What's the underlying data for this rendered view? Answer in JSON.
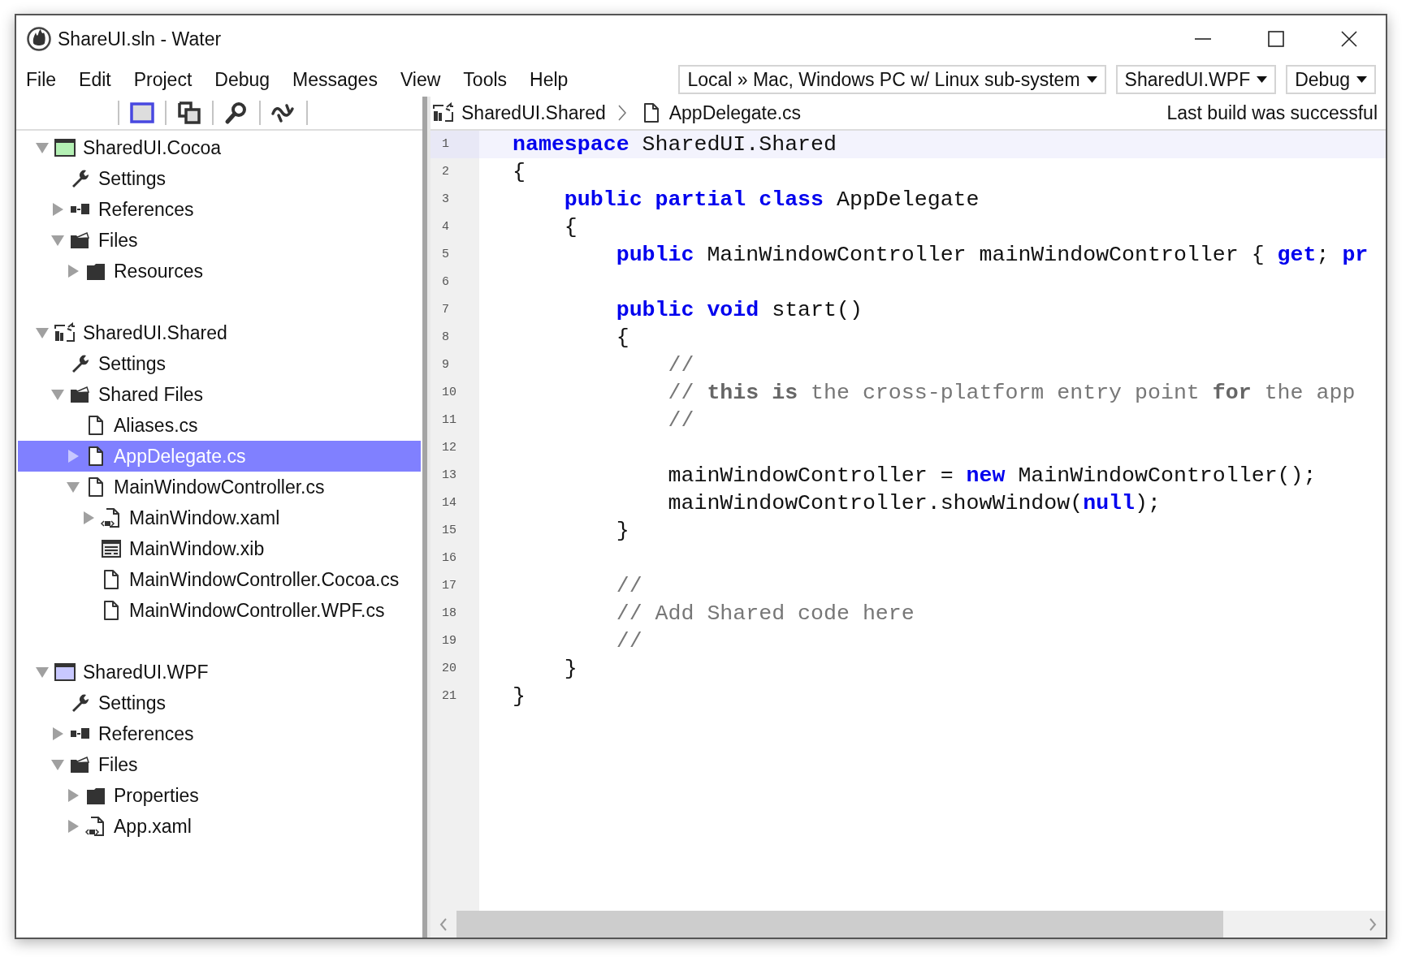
{
  "window": {
    "title": "ShareUI.sln - Water"
  },
  "menu": [
    "File",
    "Edit",
    "Project",
    "Debug",
    "Messages",
    "View",
    "Tools",
    "Help"
  ],
  "dropdowns": [
    {
      "value": "Local » Mac, Windows PC w/ Linux sub-system"
    },
    {
      "value": "SharedUI.WPF"
    },
    {
      "value": "Debug"
    }
  ],
  "toolbar": [
    {
      "kind": "square"
    },
    {
      "kind": "copy"
    },
    {
      "kind": "search"
    },
    {
      "kind": "squiggle"
    }
  ],
  "solution_tree": [
    {
      "label": "SharedUI.Cocoa",
      "kind": "window",
      "color": "#b4f0b4",
      "expanded": true,
      "selected": false,
      "children": [
        {
          "label": "Settings",
          "kind": "wrench",
          "selected": false
        },
        {
          "label": "References",
          "kind": "references",
          "expanded": false,
          "selected": false
        },
        {
          "label": "Files",
          "kind": "folder-open",
          "expanded": true,
          "selected": false,
          "children": [
            {
              "label": "Resources",
              "kind": "folder",
              "expanded": false,
              "selected": false
            }
          ]
        }
      ]
    },
    {
      "label": "SharedUI.Shared",
      "kind": "shared-project",
      "expanded": true,
      "selected": false,
      "children": [
        {
          "label": "Settings",
          "kind": "wrench",
          "selected": false
        },
        {
          "label": "Shared Files",
          "kind": "folder-open",
          "expanded": true,
          "selected": false,
          "children": [
            {
              "label": "Aliases.cs",
              "kind": "file",
              "selected": false
            },
            {
              "label": "AppDelegate.cs",
              "kind": "file",
              "expanded": false,
              "selected": true
            },
            {
              "label": "MainWindowController.cs",
              "kind": "file",
              "expanded": true,
              "selected": false,
              "children": [
                {
                  "label": "MainWindow.xaml",
                  "kind": "xaml",
                  "expanded": false,
                  "selected": false
                },
                {
                  "label": "MainWindow.xib",
                  "kind": "xib",
                  "selected": false
                },
                {
                  "label": "MainWindowController.Cocoa.cs",
                  "kind": "file",
                  "selected": false
                },
                {
                  "label": "MainWindowController.WPF.cs",
                  "kind": "file",
                  "selected": false
                }
              ]
            }
          ]
        }
      ]
    },
    {
      "label": "SharedUI.WPF",
      "kind": "window",
      "color": "#c8c8ff",
      "expanded": true,
      "selected": false,
      "children": [
        {
          "label": "Settings",
          "kind": "wrench",
          "selected": false
        },
        {
          "label": "References",
          "kind": "references",
          "expanded": false,
          "selected": false
        },
        {
          "label": "Files",
          "kind": "folder-open",
          "expanded": true,
          "selected": false,
          "children": [
            {
              "label": "Properties",
              "kind": "folder",
              "expanded": false,
              "selected": false
            },
            {
              "label": "App.xaml",
              "kind": "xaml",
              "expanded": false,
              "selected": false
            }
          ]
        }
      ]
    }
  ],
  "breadcrumb": [
    {
      "kind": "shared-project",
      "label": "SharedUI.Shared"
    },
    {
      "kind": "file",
      "label": "AppDelegate.cs"
    }
  ],
  "build_status": "Last build was successful",
  "editor": {
    "lines": [
      {
        "number": "1",
        "current": true,
        "tokens": [
          {
            "kind": "keyword",
            "text": "namespace"
          },
          {
            "kind": "plain",
            "text": " SharedUI.Shared"
          }
        ]
      },
      {
        "number": "2",
        "current": false,
        "tokens": [
          {
            "kind": "plain",
            "text": "{"
          }
        ]
      },
      {
        "number": "3",
        "current": false,
        "tokens": [
          {
            "kind": "keyword",
            "text": "    public partial class"
          },
          {
            "kind": "plain",
            "text": " AppDelegate"
          }
        ]
      },
      {
        "number": "4",
        "current": false,
        "tokens": [
          {
            "kind": "plain",
            "text": "    {"
          }
        ]
      },
      {
        "number": "5",
        "current": false,
        "tokens": [
          {
            "kind": "keyword",
            "text": "        public"
          },
          {
            "kind": "plain",
            "text": " MainWindowController mainWindowController { "
          },
          {
            "kind": "keyword",
            "text": "get"
          },
          {
            "kind": "plain",
            "text": "; "
          },
          {
            "kind": "keyword",
            "text": "pr"
          }
        ]
      },
      {
        "number": "6",
        "current": false
      },
      {
        "number": "7",
        "current": false,
        "tokens": [
          {
            "kind": "keyword",
            "text": "        public void"
          },
          {
            "kind": "plain",
            "text": " start()"
          }
        ]
      },
      {
        "number": "8",
        "current": false,
        "tokens": [
          {
            "kind": "plain",
            "text": "        {"
          }
        ]
      },
      {
        "number": "9",
        "current": false,
        "tokens": [
          {
            "kind": "comment",
            "text": "            //"
          }
        ]
      },
      {
        "number": "10",
        "current": false,
        "tokens": [
          {
            "kind": "comment",
            "text": "            // "
          },
          {
            "kind": "comment-keyword",
            "text": "this is"
          },
          {
            "kind": "comment",
            "text": " the cross-platform entry point "
          },
          {
            "kind": "comment-keyword",
            "text": "for"
          },
          {
            "kind": "comment",
            "text": " the app"
          }
        ]
      },
      {
        "number": "11",
        "current": false,
        "tokens": [
          {
            "kind": "comment",
            "text": "            //"
          }
        ]
      },
      {
        "number": "12",
        "current": false
      },
      {
        "number": "13",
        "current": false,
        "tokens": [
          {
            "kind": "plain",
            "text": "            mainWindowController = "
          },
          {
            "kind": "keyword",
            "text": "new"
          },
          {
            "kind": "plain",
            "text": " MainWindowController();"
          }
        ]
      },
      {
        "number": "14",
        "current": false,
        "tokens": [
          {
            "kind": "plain",
            "text": "            mainWindowController.showWindow("
          },
          {
            "kind": "keyword",
            "text": "null"
          },
          {
            "kind": "plain",
            "text": ");"
          }
        ]
      },
      {
        "number": "15",
        "current": false,
        "tokens": [
          {
            "kind": "plain",
            "text": "        }"
          }
        ]
      },
      {
        "number": "16",
        "current": false
      },
      {
        "number": "17",
        "current": false,
        "tokens": [
          {
            "kind": "comment",
            "text": "        //"
          }
        ]
      },
      {
        "number": "18",
        "current": false,
        "tokens": [
          {
            "kind": "comment",
            "text": "        // Add Shared code here"
          }
        ]
      },
      {
        "number": "19",
        "current": false,
        "tokens": [
          {
            "kind": "comment",
            "text": "        //"
          }
        ]
      },
      {
        "number": "20",
        "current": false,
        "tokens": [
          {
            "kind": "plain",
            "text": "    }"
          }
        ]
      },
      {
        "number": "21",
        "current": false,
        "tokens": [
          {
            "kind": "plain",
            "text": "}"
          }
        ]
      }
    ]
  }
}
